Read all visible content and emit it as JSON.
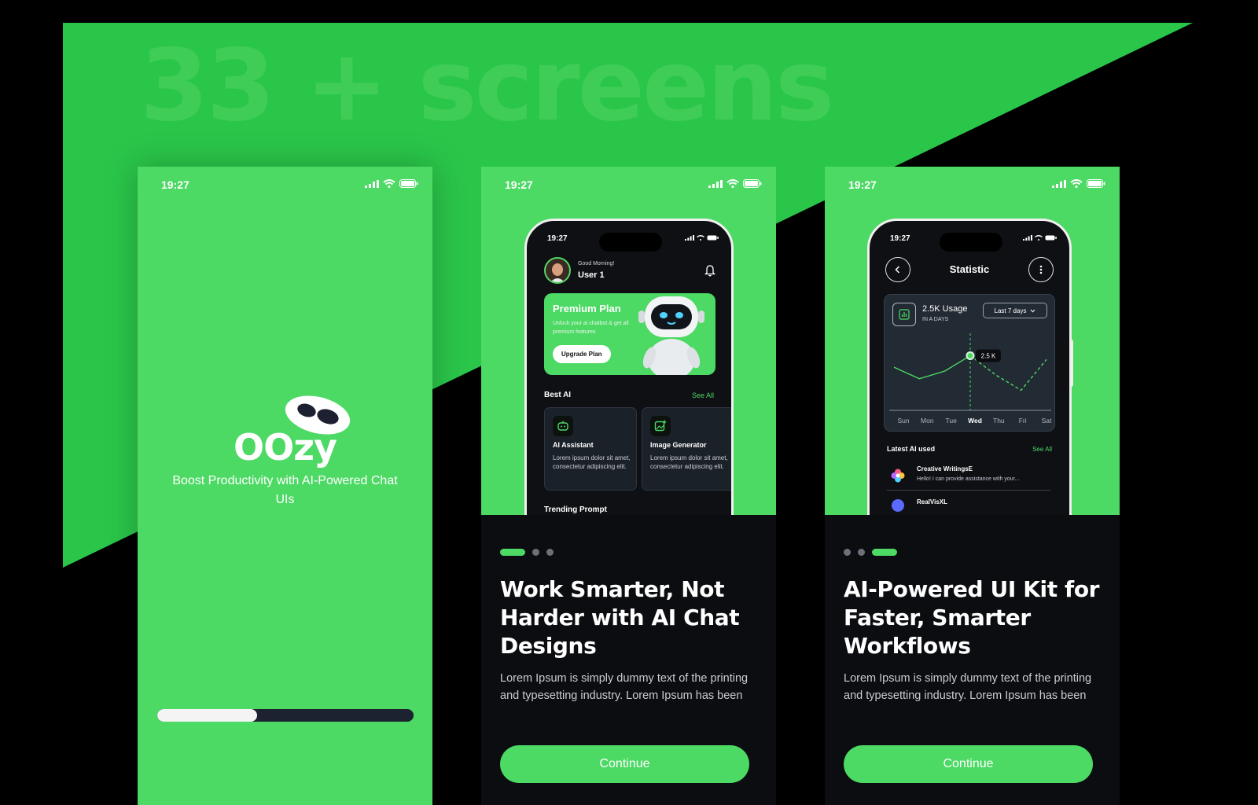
{
  "headline": "33 + screens",
  "colors": {
    "brand_green": "#4cd964",
    "headline_green": "#45cf5a",
    "dark_bg": "#0c0d10",
    "card_bg": "#1b2129"
  },
  "status_bar": {
    "time": "19:27"
  },
  "splash": {
    "logo_text": "OOzy",
    "tagline": "Boost Productivity with AI-Powered Chat UIs",
    "progress": 0.39
  },
  "screen2": {
    "device": {
      "time": "19:27",
      "greeting": "Good Morning!",
      "user_name": "User 1",
      "plan": {
        "title": "Premium Plan",
        "desc": "Unlock your ai chatbot & get all premium features",
        "button": "Upgrade Plan"
      },
      "best_ai": {
        "title": "Best AI",
        "see_all": "See All",
        "cards": [
          {
            "icon": "robot-icon",
            "name": "AI Assistant",
            "desc": "Lorem ipsum dolor sit amet, consectetur adipiscing elit."
          },
          {
            "icon": "image-plus-icon",
            "name": "Image Generator",
            "desc": "Lorem ipsum dolor sit amet, consectetur adipiscing elit."
          }
        ]
      },
      "trending": "Trending Prompt"
    },
    "title": "Work Smarter, Not Harder with AI Chat Designs",
    "desc": "Lorem Ipsum is simply dummy text of the printing and typesetting industry. Lorem Ipsum has been",
    "button": "Continue",
    "active_dot": 0
  },
  "screen3": {
    "device": {
      "time": "19:27",
      "title": "Statistic",
      "usage_value": "2.5K Usage",
      "usage_sub": "IN A DAYS",
      "range": "Last 7 days",
      "tooltip": "2.5 K",
      "latest_title": "Latest AI used",
      "latest_see_all": "See All",
      "latest": [
        {
          "icon": "flower-icon",
          "name": "Creative WritingsE",
          "desc": "Hello! I can provide assistance with your..."
        },
        {
          "icon": "sphere-icon",
          "name": "RealVisXL",
          "desc": ""
        }
      ]
    },
    "title": "AI-Powered UI Kit for Faster, Smarter Workflows",
    "desc": "Lorem Ipsum is simply dummy text of the printing and typesetting industry. Lorem Ipsum has been",
    "button": "Continue",
    "active_dot": 2
  },
  "chart_data": {
    "type": "line",
    "categories": [
      "Sun",
      "Mon",
      "Tue",
      "Wed",
      "Thu",
      "Fri",
      "Sat"
    ],
    "highlight": "Wed",
    "series": [
      {
        "values": [
          2.2,
          1.9,
          2.1,
          2.5,
          2.0,
          1.6,
          2.4
        ]
      }
    ],
    "solid_until": "Wed",
    "ylim": [
      1.2,
      3.0
    ],
    "grid": false
  }
}
